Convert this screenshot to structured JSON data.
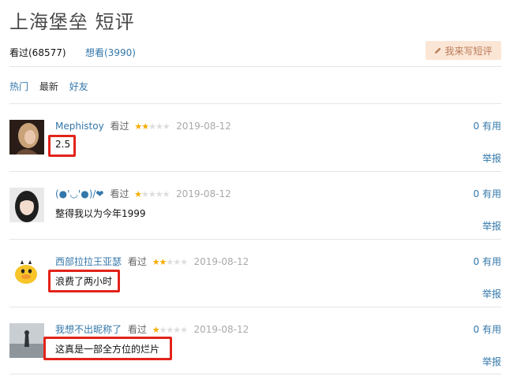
{
  "page": {
    "title": "上海堡垒 短评"
  },
  "tabs": {
    "seen": "看过(68577)",
    "want": "想看(3990)"
  },
  "write_button": {
    "label": "我来写短评"
  },
  "sort": {
    "hot": "热门",
    "new": "最新",
    "friends": "好友"
  },
  "reviews": [
    {
      "user": "Mephistoy",
      "status": "看过",
      "rating": 2,
      "date": "2019-08-12",
      "useful": "0 有用",
      "content": "2.5",
      "report": "举报"
    },
    {
      "user": "(●'◡'●)/❤",
      "status": "看过",
      "rating": 1,
      "date": "2019-08-12",
      "useful": "0 有用",
      "content": "整得我以为今年1999",
      "report": "举报"
    },
    {
      "user": "西部拉拉王亚瑟",
      "status": "看过",
      "rating": 2,
      "date": "2019-08-12",
      "useful": "0 有用",
      "content": "浪费了两小时",
      "report": "举报"
    },
    {
      "user": "我想不出昵称了",
      "status": "看过",
      "rating": 1,
      "date": "2019-08-12",
      "useful": "0 有用",
      "content": "这真是一部全方位的烂片",
      "report": "举报"
    }
  ],
  "colors": {
    "link": "#3377aa",
    "star": "#f6ab00",
    "highlight": "#e2231a",
    "button_bg": "#fbe6d6"
  }
}
